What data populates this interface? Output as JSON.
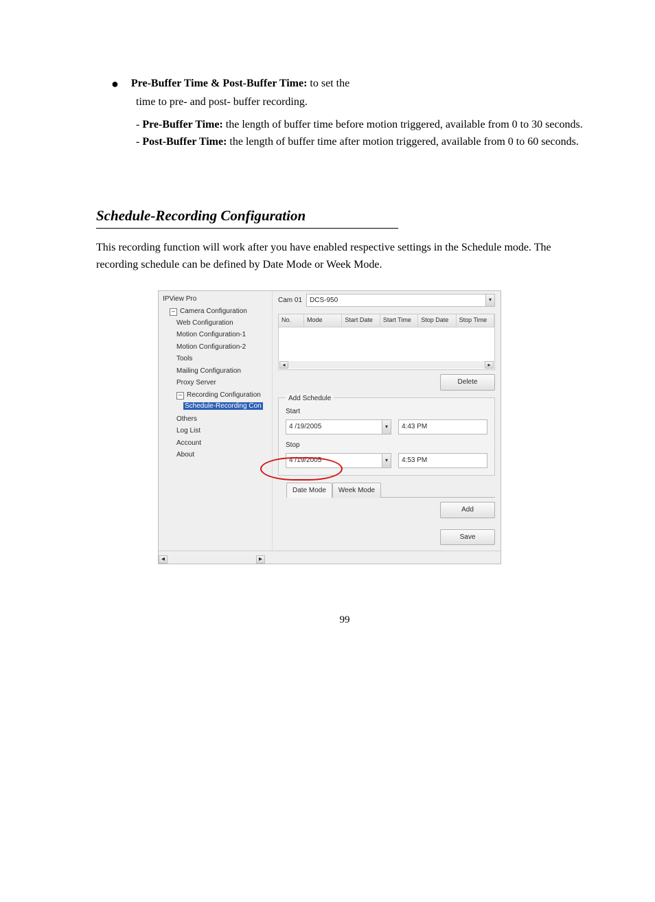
{
  "bullet": {
    "bold_lead": "Pre-Buffer Time & Post-Buffer Time:",
    "lead_text": " to set the",
    "line2": "time to pre- and post- buffer recording.",
    "sub1_bold": "Pre-Buffer Time:",
    "sub1_text": " the length of buffer time before motion triggered, available from 0 to 30 seconds.",
    "sub2_bold": "Post-Buffer Time:",
    "sub2_text": " the length of buffer time after motion triggered, available from 0 to 60 seconds."
  },
  "heading": "Schedule-Recording Configuration",
  "section_text": "This recording function will work after you have enabled respective settings in the Schedule mode. The recording schedule can be defined by Date Mode or Week Mode.",
  "shot": {
    "app": "IPView Pro",
    "cam_label": "Cam 01",
    "cam_name": "DCS-950",
    "tree": {
      "root": "Camera Configuration",
      "items": [
        "Web Configuration",
        "Motion Configuration-1",
        "Motion Configuration-2",
        "Tools",
        "Mailing Configuration",
        "Proxy Server",
        "Recording Configuration"
      ],
      "selected": "Schedule-Recording Con",
      "after": [
        "Others",
        "Log List",
        "Account",
        "About"
      ]
    },
    "table": {
      "cols": [
        "No.",
        "Mode",
        "Start Date",
        "Start Time",
        "Stop Date",
        "Stop Time"
      ]
    },
    "delete_btn": "Delete",
    "fieldset_legend": "Add Schedule",
    "start_label": "Start",
    "start_date": "4 /19/2005",
    "start_time": "4:43 PM",
    "stop_label": "Stop",
    "stop_date": "4 /19/2005",
    "stop_time": "4:53 PM",
    "tab_date": "Date Mode",
    "tab_week": "Week Mode",
    "add_btn": "Add",
    "save_btn": "Save"
  },
  "page_number": "99"
}
